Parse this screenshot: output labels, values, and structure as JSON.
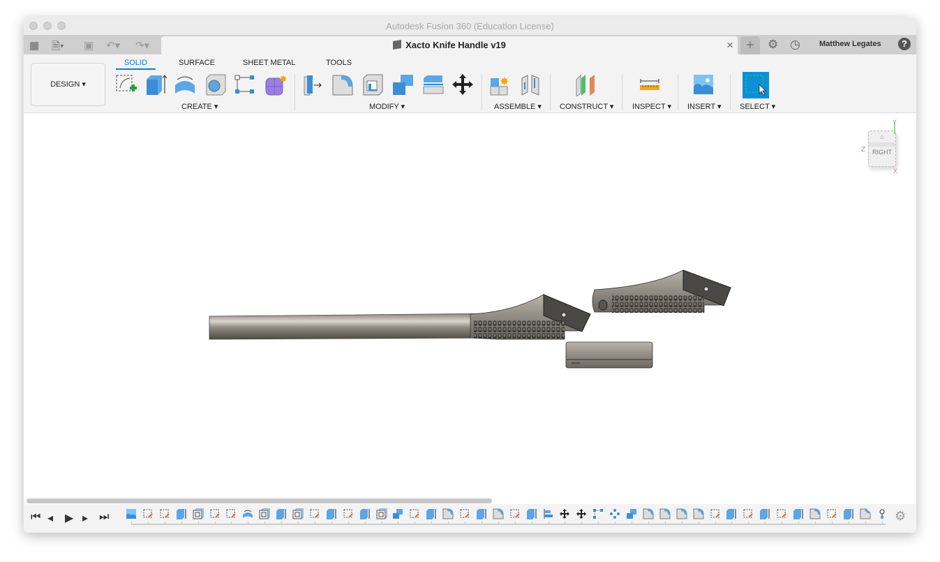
{
  "window": {
    "title": "Autodesk Fusion 360 (Education License)"
  },
  "tabbar": {
    "document_title": "Xacto Knife Handle v19",
    "user": "Matthew Legates",
    "close": "×",
    "new_tab": "+",
    "help": "?"
  },
  "toolbar": {
    "workspace": "DESIGN ▾",
    "tabs": [
      {
        "label": "SOLID",
        "active": true
      },
      {
        "label": "SURFACE"
      },
      {
        "label": "SHEET METAL"
      },
      {
        "label": "TOOLS"
      }
    ],
    "groups": [
      {
        "label": "CREATE ▾"
      },
      {
        "label": "MODIFY ▾"
      },
      {
        "label": "ASSEMBLE ▾"
      },
      {
        "label": "CONSTRUCT ▾"
      },
      {
        "label": "INSPECT ▾"
      },
      {
        "label": "INSERT ▾"
      },
      {
        "label": "SELECT ▾"
      }
    ]
  },
  "viewcube": {
    "face": "RIGHT",
    "axes": {
      "y": "Y",
      "z": "Z",
      "x": "X"
    }
  },
  "colors": {
    "accent": "#0b7ed8",
    "select_bg": "#0a90d8",
    "part": "#8c8880"
  },
  "timeline": {
    "icons": [
      "canvas",
      "sketch",
      "sketch",
      "extrude",
      "shell",
      "sketch",
      "sketch",
      "revolve",
      "shell",
      "extrude",
      "shell",
      "sketch",
      "extrude",
      "sketch",
      "extrude",
      "shell",
      "combine",
      "sketch",
      "extrude",
      "fillet",
      "sketch",
      "extrude",
      "fillet",
      "sketch",
      "extrude",
      "align",
      "move",
      "move",
      "pattern-sketch",
      "pattern",
      "combine",
      "fillet",
      "fillet",
      "fillet",
      "fillet",
      "sketch",
      "extrude",
      "sketch",
      "extrude",
      "sketch",
      "extrude",
      "fillet",
      "sketch",
      "extrude",
      "chamfer",
      "joint"
    ]
  }
}
